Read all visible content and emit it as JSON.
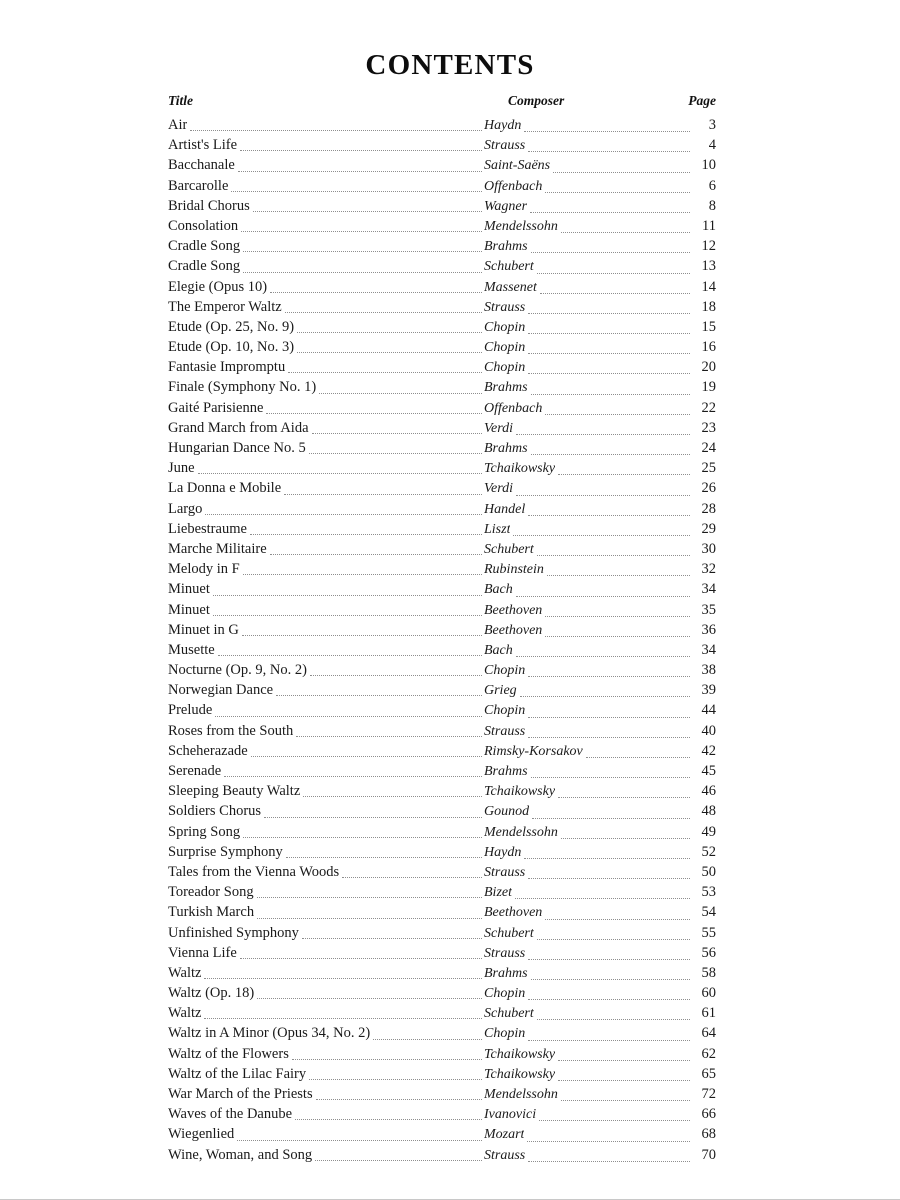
{
  "document": {
    "heading": "CONTENTS"
  },
  "table": {
    "columns": {
      "title": "Title",
      "composer": "Composer",
      "page": "Page"
    },
    "rows": [
      {
        "title": "Air",
        "composer": "Haydn",
        "page": "3"
      },
      {
        "title": "Artist's Life",
        "composer": "Strauss",
        "page": "4"
      },
      {
        "title": "Bacchanale",
        "composer": "Saint-Saëns",
        "page": "10"
      },
      {
        "title": "Barcarolle",
        "composer": "Offenbach",
        "page": "6"
      },
      {
        "title": "Bridal Chorus",
        "composer": "Wagner",
        "page": "8"
      },
      {
        "title": "Consolation",
        "composer": "Mendelssohn",
        "page": "11"
      },
      {
        "title": "Cradle Song",
        "composer": "Brahms",
        "page": "12"
      },
      {
        "title": "Cradle Song",
        "composer": "Schubert",
        "page": "13"
      },
      {
        "title": "Elegie (Opus 10)",
        "composer": "Massenet",
        "page": "14"
      },
      {
        "title": "The Emperor Waltz",
        "composer": "Strauss",
        "page": "18"
      },
      {
        "title": "Etude (Op. 25, No. 9)",
        "composer": "Chopin",
        "page": "15"
      },
      {
        "title": "Etude (Op. 10, No. 3)",
        "composer": "Chopin",
        "page": "16"
      },
      {
        "title": "Fantasie Impromptu",
        "composer": "Chopin",
        "page": "20"
      },
      {
        "title": "Finale (Symphony No. 1)",
        "composer": "Brahms",
        "page": "19"
      },
      {
        "title": "Gaité Parisienne",
        "composer": "Offenbach",
        "page": "22"
      },
      {
        "title": "Grand March from Aida",
        "composer": "Verdi",
        "page": "23"
      },
      {
        "title": "Hungarian Dance No. 5",
        "composer": "Brahms",
        "page": "24"
      },
      {
        "title": "June",
        "composer": "Tchaikowsky",
        "page": "25"
      },
      {
        "title": "La Donna e Mobile",
        "composer": "Verdi",
        "page": "26"
      },
      {
        "title": "Largo",
        "composer": "Handel",
        "page": "28"
      },
      {
        "title": "Liebestraume",
        "composer": "Liszt",
        "page": "29"
      },
      {
        "title": "Marche Militaire",
        "composer": "Schubert",
        "page": "30"
      },
      {
        "title": "Melody in F",
        "composer": "Rubinstein",
        "page": "32"
      },
      {
        "title": "Minuet",
        "composer": "Bach",
        "page": "34"
      },
      {
        "title": "Minuet",
        "composer": "Beethoven",
        "page": "35"
      },
      {
        "title": "Minuet in G",
        "composer": "Beethoven",
        "page": "36"
      },
      {
        "title": "Musette",
        "composer": "Bach",
        "page": "34"
      },
      {
        "title": "Nocturne (Op. 9, No. 2)",
        "composer": "Chopin",
        "page": "38"
      },
      {
        "title": "Norwegian Dance",
        "composer": "Grieg",
        "page": "39"
      },
      {
        "title": "Prelude",
        "composer": "Chopin",
        "page": "44"
      },
      {
        "title": "Roses from the South",
        "composer": "Strauss",
        "page": "40"
      },
      {
        "title": "Scheherazade",
        "composer": "Rimsky-Korsakov",
        "page": "42"
      },
      {
        "title": "Serenade",
        "composer": "Brahms",
        "page": "45"
      },
      {
        "title": "Sleeping Beauty Waltz",
        "composer": "Tchaikowsky",
        "page": "46"
      },
      {
        "title": "Soldiers Chorus",
        "composer": "Gounod",
        "page": "48"
      },
      {
        "title": "Spring Song",
        "composer": "Mendelssohn",
        "page": "49"
      },
      {
        "title": "Surprise Symphony",
        "composer": "Haydn",
        "page": "52"
      },
      {
        "title": "Tales from the Vienna Woods",
        "composer": "Strauss",
        "page": "50"
      },
      {
        "title": "Toreador Song",
        "composer": "Bizet",
        "page": "53"
      },
      {
        "title": "Turkish March",
        "composer": "Beethoven",
        "page": "54"
      },
      {
        "title": "Unfinished Symphony",
        "composer": "Schubert",
        "page": "55"
      },
      {
        "title": "Vienna Life",
        "composer": "Strauss",
        "page": "56"
      },
      {
        "title": "Waltz",
        "composer": "Brahms",
        "page": "58"
      },
      {
        "title": "Waltz (Op. 18)",
        "composer": "Chopin",
        "page": "60"
      },
      {
        "title": "Waltz",
        "composer": "Schubert",
        "page": "61"
      },
      {
        "title": "Waltz in A Minor (Opus 34, No. 2)",
        "composer": "Chopin",
        "page": "64"
      },
      {
        "title": "Waltz of the Flowers",
        "composer": "Tchaikowsky",
        "page": "62"
      },
      {
        "title": "Waltz of the Lilac Fairy",
        "composer": "Tchaikowsky",
        "page": "65"
      },
      {
        "title": "War March of the Priests",
        "composer": "Mendelssohn",
        "page": "72"
      },
      {
        "title": "Waves of the Danube",
        "composer": "Ivanovici",
        "page": "66"
      },
      {
        "title": "Wiegenlied",
        "composer": "Mozart",
        "page": "68"
      },
      {
        "title": "Wine, Woman, and Song",
        "composer": "Strauss",
        "page": "70"
      }
    ]
  }
}
